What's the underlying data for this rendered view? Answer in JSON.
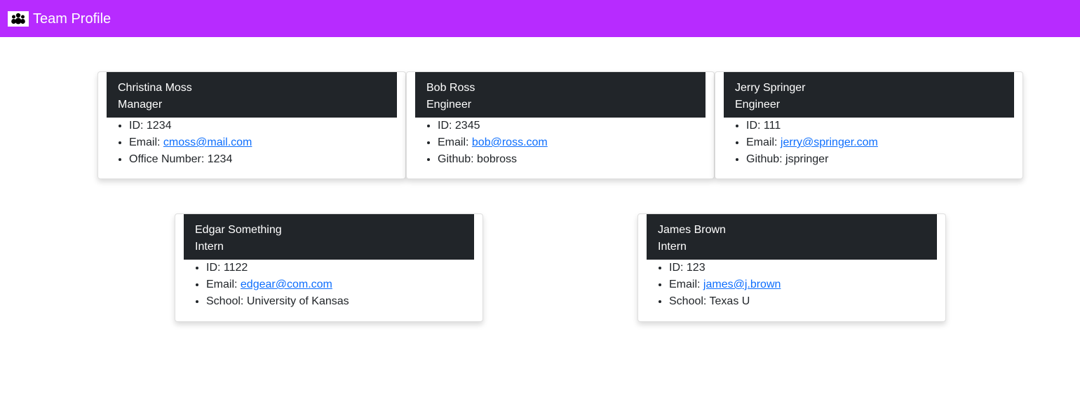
{
  "header": {
    "title": "Team Profile",
    "logo_icon": "team-icon",
    "background": "#b72bff"
  },
  "members": [
    {
      "name": "Christina Moss",
      "role": "Manager",
      "id_label": "ID:",
      "id": "1234",
      "email_label": "Email:",
      "email": "cmoss@mail.com",
      "extra_label": "Office Number:",
      "extra": "1234"
    },
    {
      "name": "Bob Ross",
      "role": "Engineer",
      "id_label": "ID:",
      "id": "2345",
      "email_label": "Email:",
      "email": "bob@ross.com",
      "extra_label": "Github:",
      "extra": "bobross"
    },
    {
      "name": "Jerry Springer",
      "role": "Engineer",
      "id_label": "ID:",
      "id": "111",
      "email_label": "Email:",
      "email": "jerry@springer.com",
      "extra_label": "Github:",
      "extra": "jspringer"
    },
    {
      "name": "Edgar Something",
      "role": "Intern",
      "id_label": "ID:",
      "id": "1122",
      "email_label": "Email:",
      "email": "edgear@com.com",
      "extra_label": "School:",
      "extra": "University of Kansas"
    },
    {
      "name": "James Brown",
      "role": "Intern",
      "id_label": "ID:",
      "id": "123",
      "email_label": "Email:",
      "email": "james@j.brown",
      "extra_label": "School:",
      "extra": "Texas U"
    }
  ]
}
